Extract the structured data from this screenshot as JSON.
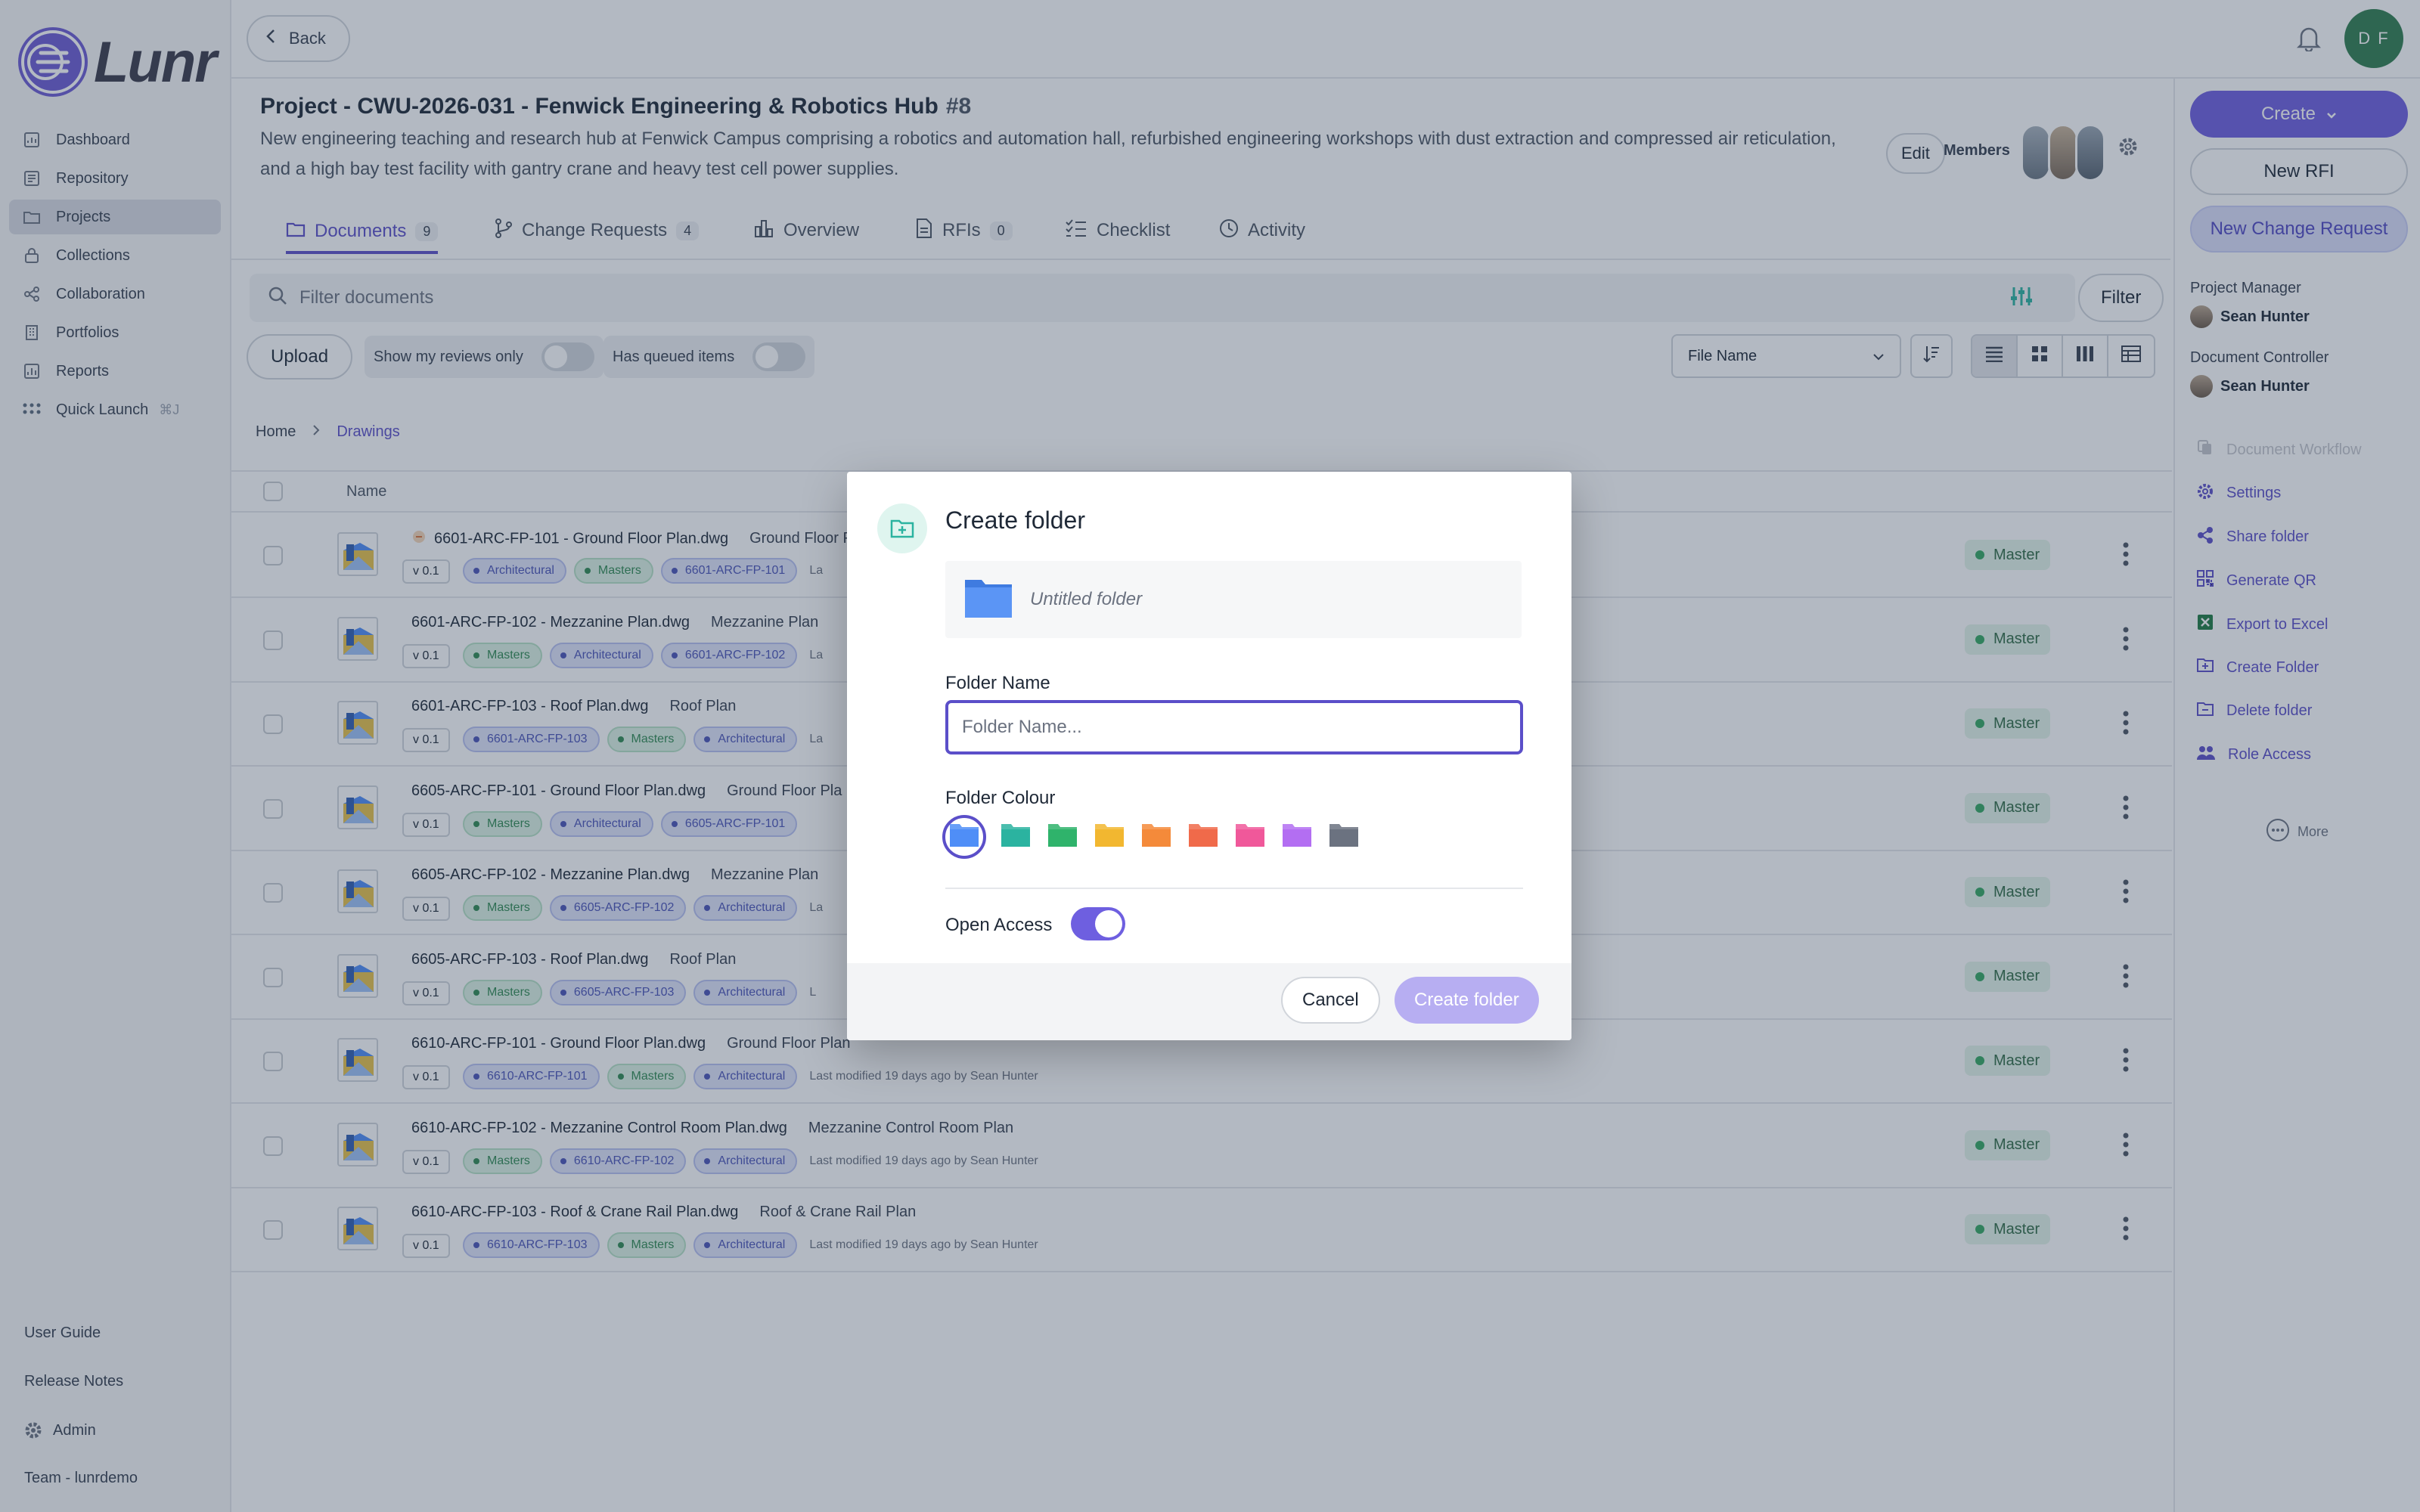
{
  "app": {
    "name": "Lunr"
  },
  "sidebar": {
    "items": [
      {
        "label": "Dashboard",
        "icon": "dashboard-icon"
      },
      {
        "label": "Repository",
        "icon": "repository-icon"
      },
      {
        "label": "Projects",
        "icon": "folder-icon",
        "active": true
      },
      {
        "label": "Collections",
        "icon": "lock-icon"
      },
      {
        "label": "Collaboration",
        "icon": "share-icon"
      },
      {
        "label": "Portfolios",
        "icon": "building-icon"
      },
      {
        "label": "Reports",
        "icon": "chart-icon"
      },
      {
        "label": "Quick Launch",
        "icon": "grid-icon",
        "shortcut": "⌘J"
      }
    ],
    "bottom": {
      "user_guide": "User Guide",
      "release_notes": "Release Notes",
      "admin": "Admin",
      "team": "Team - lunrdemo"
    }
  },
  "topbar": {
    "back_label": "Back",
    "user_initials": "D F"
  },
  "project": {
    "title": "Project - CWU-2026-031 - Fenwick Engineering & Robotics Hub",
    "number": "#8",
    "description": "New engineering teaching and research hub at Fenwick Campus comprising a robotics and automation hall, refurbished engineering workshops with dust extraction and compressed air reticulation, and a high bay test facility with gantry crane and heavy test cell power supplies.",
    "edit_label": "Edit",
    "members_label": "Members"
  },
  "tabs": [
    {
      "label": "Documents",
      "count": "9",
      "active": true
    },
    {
      "label": "Change Requests",
      "count": "4"
    },
    {
      "label": "Overview",
      "count": null
    },
    {
      "label": "RFIs",
      "count": "0"
    },
    {
      "label": "Checklist",
      "count": null
    },
    {
      "label": "Activity",
      "count": null
    }
  ],
  "toolbar": {
    "filter_placeholder": "Filter documents",
    "filter_label": "Filter",
    "upload_label": "Upload",
    "show_reviews_label": "Show my reviews only",
    "queued_label": "Has queued items",
    "sort_value": "File Name"
  },
  "breadcrumb": {
    "home": "Home",
    "current": "Drawings"
  },
  "table": {
    "name_header": "Name",
    "rows": [
      {
        "file": "6601-ARC-FP-101 - Ground Floor Plan.dwg",
        "desc": "Ground Floor P",
        "version": "v 0.1",
        "tags": [
          {
            "t": "Architectural",
            "c": "blue"
          },
          {
            "t": "Masters",
            "c": "green"
          },
          {
            "t": "6601-ARC-FP-101",
            "c": "blue"
          }
        ],
        "modified": "La",
        "status": "Master",
        "locked": true
      },
      {
        "file": "6601-ARC-FP-102 - Mezzanine Plan.dwg",
        "desc": "Mezzanine Plan",
        "version": "v 0.1",
        "tags": [
          {
            "t": "Masters",
            "c": "green"
          },
          {
            "t": "Architectural",
            "c": "blue"
          },
          {
            "t": "6601-ARC-FP-102",
            "c": "blue"
          }
        ],
        "modified": "La",
        "status": "Master"
      },
      {
        "file": "6601-ARC-FP-103 - Roof Plan.dwg",
        "desc": "Roof Plan",
        "version": "v 0.1",
        "tags": [
          {
            "t": "6601-ARC-FP-103",
            "c": "blue"
          },
          {
            "t": "Masters",
            "c": "green"
          },
          {
            "t": "Architectural",
            "c": "blue"
          }
        ],
        "modified": "La",
        "status": "Master"
      },
      {
        "file": "6605-ARC-FP-101 - Ground Floor Plan.dwg",
        "desc": "Ground Floor Pla",
        "version": "v 0.1",
        "tags": [
          {
            "t": "Masters",
            "c": "green"
          },
          {
            "t": "Architectural",
            "c": "blue"
          },
          {
            "t": "6605-ARC-FP-101",
            "c": "blue"
          }
        ],
        "modified": "",
        "status": "Master"
      },
      {
        "file": "6605-ARC-FP-102 - Mezzanine Plan.dwg",
        "desc": "Mezzanine Plan",
        "version": "v 0.1",
        "tags": [
          {
            "t": "Masters",
            "c": "green"
          },
          {
            "t": "6605-ARC-FP-102",
            "c": "blue"
          },
          {
            "t": "Architectural",
            "c": "blue"
          }
        ],
        "modified": "La",
        "status": "Master"
      },
      {
        "file": "6605-ARC-FP-103 - Roof Plan.dwg",
        "desc": "Roof Plan",
        "version": "v 0.1",
        "tags": [
          {
            "t": "Masters",
            "c": "green"
          },
          {
            "t": "6605-ARC-FP-103",
            "c": "blue"
          },
          {
            "t": "Architectural",
            "c": "blue"
          }
        ],
        "modified": "L",
        "status": "Master"
      },
      {
        "file": "6610-ARC-FP-101 - Ground Floor Plan.dwg",
        "desc": "Ground Floor Plan",
        "version": "v 0.1",
        "tags": [
          {
            "t": "6610-ARC-FP-101",
            "c": "blue"
          },
          {
            "t": "Masters",
            "c": "green"
          },
          {
            "t": "Architectural",
            "c": "blue"
          }
        ],
        "modified": "Last modified 19 days ago by Sean Hunter",
        "status": "Master"
      },
      {
        "file": "6610-ARC-FP-102 - Mezzanine Control Room Plan.dwg",
        "desc": "Mezzanine Control Room Plan",
        "version": "v 0.1",
        "tags": [
          {
            "t": "Masters",
            "c": "green"
          },
          {
            "t": "6610-ARC-FP-102",
            "c": "blue"
          },
          {
            "t": "Architectural",
            "c": "blue"
          }
        ],
        "modified": "Last modified 19 days ago by Sean Hunter",
        "status": "Master"
      },
      {
        "file": "6610-ARC-FP-103 - Roof & Crane Rail Plan.dwg",
        "desc": "Roof & Crane Rail Plan",
        "version": "v 0.1",
        "tags": [
          {
            "t": "6610-ARC-FP-103",
            "c": "blue"
          },
          {
            "t": "Masters",
            "c": "green"
          },
          {
            "t": "Architectural",
            "c": "blue"
          }
        ],
        "modified": "Last modified 19 days ago by Sean Hunter",
        "status": "Master"
      }
    ]
  },
  "right_panel": {
    "create_label": "Create",
    "new_rfi_label": "New RFI",
    "new_cr_label": "New Change Request",
    "pm_label": "Project Manager",
    "pm_name": "Sean Hunter",
    "dc_label": "Document Controller",
    "dc_name": "Sean Hunter",
    "actions": [
      {
        "label": "Document Workflow",
        "icon": "workflow-icon",
        "disabled": true
      },
      {
        "label": "Settings",
        "icon": "gear-icon"
      },
      {
        "label": "Share folder",
        "icon": "share-icon"
      },
      {
        "label": "Generate QR",
        "icon": "qr-icon"
      },
      {
        "label": "Export to Excel",
        "icon": "excel-icon"
      },
      {
        "label": "Create Folder",
        "icon": "folder-plus-icon"
      },
      {
        "label": "Delete folder",
        "icon": "folder-minus-icon"
      },
      {
        "label": "Role Access",
        "icon": "users-icon"
      }
    ],
    "more_label": "More"
  },
  "modal": {
    "title": "Create folder",
    "preview_name": "Untitled folder",
    "folder_name_label": "Folder Name",
    "folder_name_placeholder": "Folder Name...",
    "folder_name_value": "",
    "colour_label": "Folder Colour",
    "colours": [
      "#4f8ef7",
      "#2bb3a0",
      "#2fb36b",
      "#f2b730",
      "#f48a3a",
      "#f06a4a",
      "#f0589a",
      "#b36ef2",
      "#6b7280"
    ],
    "selected_colour": "#4f8ef7",
    "open_access_label": "Open Access",
    "open_access_on": true,
    "cancel_label": "Cancel",
    "create_label": "Create folder"
  }
}
